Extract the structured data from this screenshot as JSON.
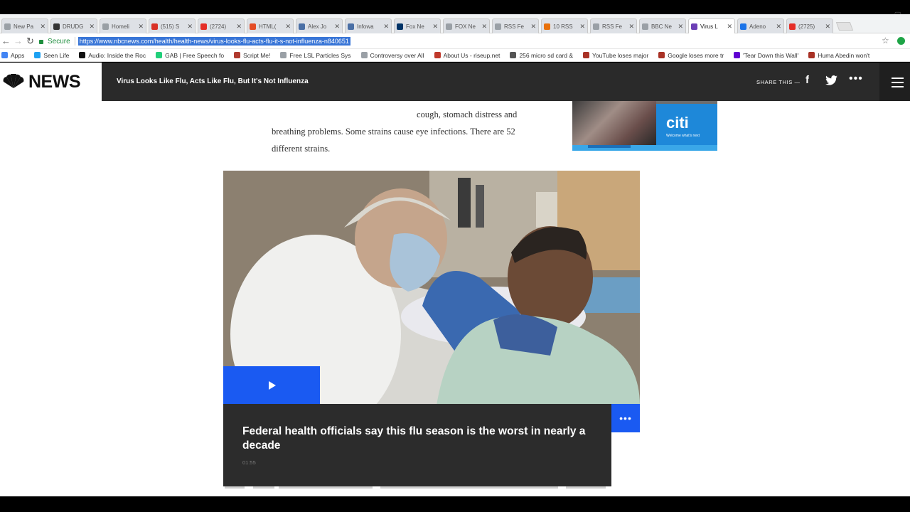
{
  "browser": {
    "tabs": [
      {
        "label": "New Pa",
        "color": "#9aa0a6"
      },
      {
        "label": "DRUDG",
        "color": "#333333"
      },
      {
        "label": "Homeli",
        "color": "#9aa0a6"
      },
      {
        "label": "(515) S",
        "color": "#d93025"
      },
      {
        "label": "(2724)",
        "color": "#e52d27"
      },
      {
        "label": "HTML(",
        "color": "#e44d26"
      },
      {
        "label": "Alex Jo",
        "color": "#4a6fa5"
      },
      {
        "label": "Infowa",
        "color": "#4a6fa5"
      },
      {
        "label": "Fox Ne",
        "color": "#003366"
      },
      {
        "label": "FOX Ne",
        "color": "#9aa0a6"
      },
      {
        "label": "RSS Fe",
        "color": "#9aa0a6"
      },
      {
        "label": "10 RSS",
        "color": "#e8710a"
      },
      {
        "label": "RSS Fe",
        "color": "#9aa0a6"
      },
      {
        "label": "BBC Ne",
        "color": "#9aa0a6"
      },
      {
        "label": "Virus L",
        "color": "#6c3fb5",
        "active": true
      },
      {
        "label": "Adeno",
        "color": "#1a73e8"
      },
      {
        "label": "(2725)",
        "color": "#e52d27"
      }
    ],
    "secure_label": "Secure",
    "url": "https://www.nbcnews.com/health/health-news/virus-looks-flu-acts-flu-it-s-not-influenza-n840651",
    "bookmarks": [
      {
        "label": "Apps",
        "color": "#4285f4"
      },
      {
        "label": "Seen Life",
        "color": "#1da1f2"
      },
      {
        "label": "Audio: Inside the Roc",
        "color": "#111111"
      },
      {
        "label": "GAB | Free Speech fo",
        "color": "#21cf7a"
      },
      {
        "label": "Script Me!",
        "color": "#b03a2e"
      },
      {
        "label": "Free LSL Particles Sys",
        "color": "#9aa0a6"
      },
      {
        "label": "Controversy over All",
        "color": "#9aa0a6"
      },
      {
        "label": "About Us - riseup.net",
        "color": "#c0392b"
      },
      {
        "label": "256 micro sd card &",
        "color": "#555555"
      },
      {
        "label": "YouTube loses major",
        "color": "#a93226"
      },
      {
        "label": "Google loses more tr",
        "color": "#a93226"
      },
      {
        "label": "'Tear Down this Wall'",
        "color": "#6001d2"
      },
      {
        "label": "Huma Abedin won't",
        "color": "#a93226"
      }
    ]
  },
  "header": {
    "logo_text": "NEWS",
    "headline": "Virus Looks Like Flu, Acts Like Flu, But It's Not Influenza",
    "share_label": "SHARE THIS —",
    "facebook_glyph": "f",
    "more_glyph": "•••"
  },
  "article": {
    "line1": "cough, stomach distress and",
    "line2": "breathing problems. Some strains cause eye infections. There are 52",
    "line3": "different strains."
  },
  "ad": {
    "brand": "citi",
    "tagline": "Welcome what's next"
  },
  "video": {
    "caption": "Federal health officials say this flu season is the worst in nearly a decade",
    "duration": "01:55",
    "more_glyph": "•••"
  }
}
